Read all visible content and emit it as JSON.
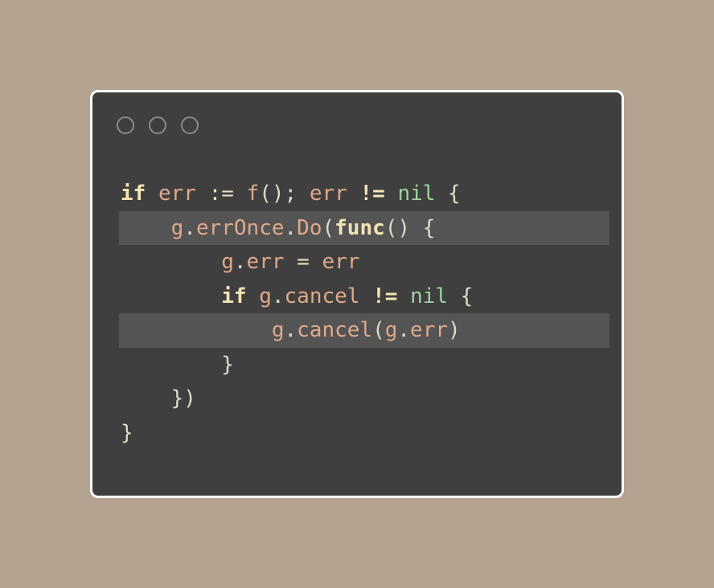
{
  "window": {
    "controls": [
      "circle",
      "circle",
      "circle"
    ]
  },
  "code": {
    "lines": [
      {
        "indent": "",
        "highlight": false,
        "tokens": [
          {
            "t": "if",
            "c": "kw"
          },
          {
            "t": " ",
            "c": "punct"
          },
          {
            "t": "err",
            "c": "ident"
          },
          {
            "t": " := ",
            "c": "op"
          },
          {
            "t": "f",
            "c": "ident"
          },
          {
            "t": "(); ",
            "c": "punct"
          },
          {
            "t": "err",
            "c": "ident"
          },
          {
            "t": " ",
            "c": "punct"
          },
          {
            "t": "!=",
            "c": "kw"
          },
          {
            "t": " ",
            "c": "punct"
          },
          {
            "t": "nil",
            "c": "nil"
          },
          {
            "t": " {",
            "c": "punct"
          }
        ]
      },
      {
        "indent": "    ",
        "highlight": true,
        "tokens": [
          {
            "t": "g",
            "c": "ident"
          },
          {
            "t": ".",
            "c": "punct"
          },
          {
            "t": "errOnce",
            "c": "ident"
          },
          {
            "t": ".",
            "c": "punct"
          },
          {
            "t": "Do",
            "c": "ident"
          },
          {
            "t": "(",
            "c": "punct"
          },
          {
            "t": "func",
            "c": "kw"
          },
          {
            "t": "() {",
            "c": "punct"
          }
        ]
      },
      {
        "indent": "        ",
        "highlight": false,
        "tokens": [
          {
            "t": "g",
            "c": "ident"
          },
          {
            "t": ".",
            "c": "punct"
          },
          {
            "t": "err",
            "c": "ident"
          },
          {
            "t": " = ",
            "c": "op"
          },
          {
            "t": "err",
            "c": "ident"
          }
        ]
      },
      {
        "indent": "        ",
        "highlight": false,
        "tokens": [
          {
            "t": "if",
            "c": "kw"
          },
          {
            "t": " ",
            "c": "punct"
          },
          {
            "t": "g",
            "c": "ident"
          },
          {
            "t": ".",
            "c": "punct"
          },
          {
            "t": "cancel",
            "c": "ident"
          },
          {
            "t": " ",
            "c": "punct"
          },
          {
            "t": "!=",
            "c": "kw"
          },
          {
            "t": " ",
            "c": "punct"
          },
          {
            "t": "nil",
            "c": "nil"
          },
          {
            "t": " {",
            "c": "punct"
          }
        ]
      },
      {
        "indent": "            ",
        "highlight": true,
        "tokens": [
          {
            "t": "g",
            "c": "ident"
          },
          {
            "t": ".",
            "c": "punct"
          },
          {
            "t": "cancel",
            "c": "ident"
          },
          {
            "t": "(",
            "c": "punct"
          },
          {
            "t": "g",
            "c": "ident"
          },
          {
            "t": ".",
            "c": "punct"
          },
          {
            "t": "err",
            "c": "ident"
          },
          {
            "t": ")",
            "c": "punct"
          }
        ]
      },
      {
        "indent": "        ",
        "highlight": false,
        "tokens": [
          {
            "t": "}",
            "c": "punct"
          }
        ]
      },
      {
        "indent": "    ",
        "highlight": false,
        "tokens": [
          {
            "t": "})",
            "c": "punct"
          }
        ]
      },
      {
        "indent": "",
        "highlight": false,
        "tokens": [
          {
            "t": "}",
            "c": "punct"
          }
        ]
      }
    ]
  },
  "colors": {
    "background": "#b5a392",
    "window": "#3f3f3f",
    "highlight_line": "#545454",
    "identifier": "#dea98a",
    "keyword": "#f2e4b4",
    "nil": "#9fd1a0",
    "punctuation": "#dcdcc8"
  }
}
